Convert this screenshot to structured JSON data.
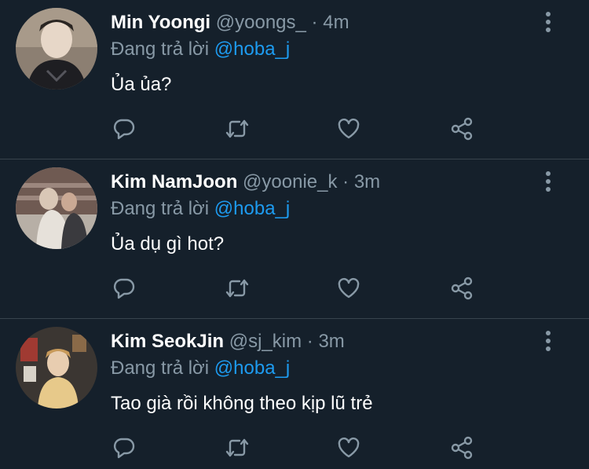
{
  "colors": {
    "background": "#15202b",
    "divider": "#38444d",
    "secondary_text": "#8899a6",
    "mention": "#1d9bf0"
  },
  "tweets": [
    {
      "name": "Min Yoongi",
      "handle": "@yoongs_",
      "separator": "·",
      "time": "4m",
      "replying_prefix": "Đang trả lời",
      "replying_to": "@hoba_j",
      "text": "Ủa ủa?"
    },
    {
      "name": "Kim NamJoon",
      "handle": "@yoonie_k",
      "separator": "·",
      "time": "3m",
      "replying_prefix": "Đang trả lời",
      "replying_to": "@hoba_j",
      "text": "Ủa dụ gì hot?"
    },
    {
      "name": "Kim SeokJin",
      "handle": "@sj_kim",
      "separator": "·",
      "time": "3m",
      "replying_prefix": "Đang trả lời",
      "replying_to": "@hoba_j",
      "text": "Tao già rồi không theo kịp lũ trẻ"
    }
  ],
  "action_icons": [
    "reply-icon",
    "retweet-icon",
    "like-icon",
    "share-icon"
  ]
}
